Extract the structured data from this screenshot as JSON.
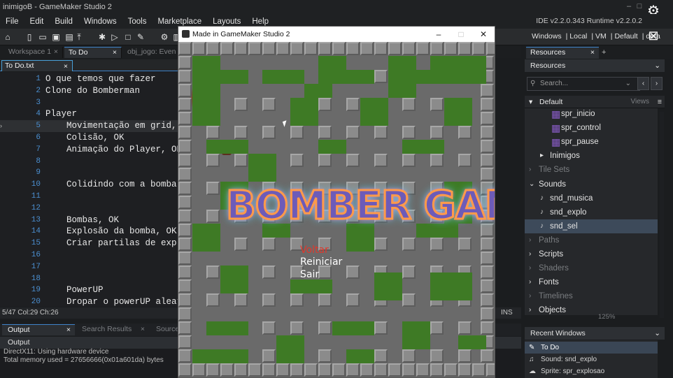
{
  "window": {
    "title": "inimigoB - GameMaker Studio 2",
    "version": "IDE v2.2.0.343 Runtime v2.2.0.2"
  },
  "menu": [
    "File",
    "Edit",
    "Build",
    "Windows",
    "Tools",
    "Marketplace",
    "Layouts",
    "Help"
  ],
  "targets": [
    "Windows",
    "Local",
    "VM",
    "Default",
    "defa"
  ],
  "workspace_tabs": [
    "Workspace 1",
    "To Do",
    "obj_jogo: Even"
  ],
  "doc_tab": "To Do.txt",
  "editor": {
    "lines": [
      {
        "n": "1",
        "text": "O que temos que fazer"
      },
      {
        "n": "2",
        "text": "Clone do Bomberman"
      },
      {
        "n": "3",
        "text": ""
      },
      {
        "n": "4",
        "text": "Player"
      },
      {
        "n": "5",
        "text": "    Movimentação em grid, O"
      },
      {
        "n": "6",
        "text": "    Colisão, OK"
      },
      {
        "n": "7",
        "text": "    Animação do Player, OK"
      },
      {
        "n": "8",
        "text": ""
      },
      {
        "n": "9",
        "text": ""
      },
      {
        "n": "10",
        "text": "    Colidindo com a bomba,"
      },
      {
        "n": "11",
        "text": ""
      },
      {
        "n": "12",
        "text": ""
      },
      {
        "n": "13",
        "text": "    Bombas, OK"
      },
      {
        "n": "14",
        "text": "    Explosão da bomba, OK"
      },
      {
        "n": "15",
        "text": "    Criar partilas de explo"
      },
      {
        "n": "16",
        "text": ""
      },
      {
        "n": "17",
        "text": ""
      },
      {
        "n": "18",
        "text": ""
      },
      {
        "n": "19",
        "text": "    PowerUP"
      },
      {
        "n": "20",
        "text": "    Dropar o powerUP aleato"
      }
    ]
  },
  "status": {
    "position": "5/47 Col:29 Ch:26",
    "mode": "INS"
  },
  "output_tabs": [
    "Output",
    "Search Results",
    "Source"
  ],
  "output": {
    "title": "Output",
    "lines": [
      "DirectX11: Using hardware device",
      "Total memory used = 27656666(0x01a601da) bytes"
    ]
  },
  "resources": {
    "tab": "Resources",
    "header": "Resources",
    "search_placeholder": "Search...",
    "filter": "Default",
    "views_label": "Views",
    "tree": [
      {
        "label": "spr_inicio",
        "indent": 4,
        "kind": "sprite"
      },
      {
        "label": "spr_control",
        "indent": 4,
        "kind": "sprite"
      },
      {
        "label": "spr_pause",
        "indent": 4,
        "kind": "sprite"
      },
      {
        "label": "Inimigos",
        "indent": 2,
        "kind": "folder"
      },
      {
        "label": "Tile Sets",
        "indent": 0,
        "kind": "group-dim"
      },
      {
        "label": "Sounds",
        "indent": 0,
        "kind": "group-open"
      },
      {
        "label": "snd_musica",
        "indent": 2,
        "kind": "sound"
      },
      {
        "label": "snd_explo",
        "indent": 2,
        "kind": "sound"
      },
      {
        "label": "snd_sel",
        "indent": 2,
        "kind": "sound-sel"
      },
      {
        "label": "Paths",
        "indent": 0,
        "kind": "group-dim"
      },
      {
        "label": "Scripts",
        "indent": 0,
        "kind": "group"
      },
      {
        "label": "Shaders",
        "indent": 0,
        "kind": "group-dim"
      },
      {
        "label": "Fonts",
        "indent": 0,
        "kind": "group"
      },
      {
        "label": "Timelines",
        "indent": 0,
        "kind": "group-dim"
      },
      {
        "label": "Objects",
        "indent": 0,
        "kind": "group"
      }
    ],
    "zoom": "125%"
  },
  "recent": {
    "title": "Recent Windows",
    "items": [
      "To Do",
      "Sound: snd_explo",
      "Sprite: spr_explosao"
    ]
  },
  "game": {
    "title": "Made in GameMaker Studio 2",
    "logo": "BOMBER GAME",
    "options": [
      "Voltar",
      "Reiniciar",
      "Sair"
    ],
    "selected_option": 0
  }
}
